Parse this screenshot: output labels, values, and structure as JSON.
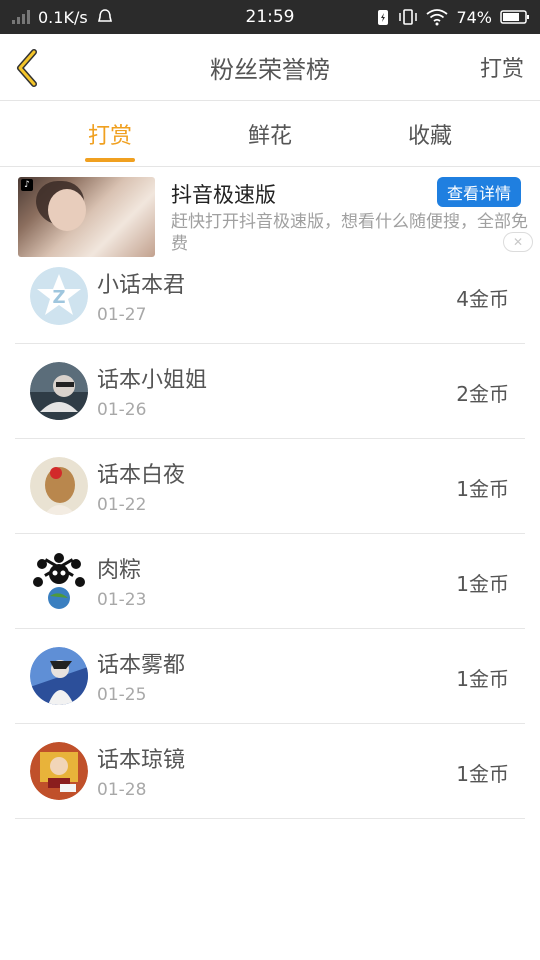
{
  "statusbar": {
    "net_speed": "0.1K/s",
    "time": "21:59",
    "battery": "74%"
  },
  "navbar": {
    "title": "粉丝荣誉榜",
    "right_action": "打赏"
  },
  "tabs": [
    {
      "label": "打赏",
      "active": true
    },
    {
      "label": "鲜花",
      "active": false
    },
    {
      "label": "收藏",
      "active": false
    }
  ],
  "ad": {
    "title": "抖音极速版",
    "cta": "查看详情",
    "description": "赶快打开抖音极速版，想看什么随便搜，全部免费"
  },
  "fans": [
    {
      "name": "小话本君",
      "date": "01-27",
      "amount": "4金币"
    },
    {
      "name": "话本小姐姐",
      "date": "01-26",
      "amount": "2金币"
    },
    {
      "name": "话本白夜",
      "date": "01-22",
      "amount": "1金币"
    },
    {
      "name": "肉粽",
      "date": "01-23",
      "amount": "1金币"
    },
    {
      "name": "话本雾都",
      "date": "01-25",
      "amount": "1金币"
    },
    {
      "name": "话本琼镜",
      "date": "01-28",
      "amount": "1金币"
    }
  ],
  "colors": {
    "accent": "#f0a020",
    "cta": "#1f7fe0",
    "statusbar": "#2b2b2b"
  }
}
